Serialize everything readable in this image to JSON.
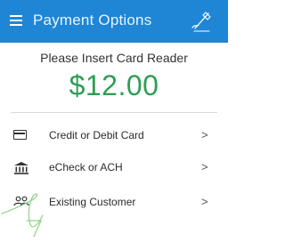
{
  "header": {
    "title": "Payment Options",
    "menu_icon": "hamburger-menu-icon",
    "signature_icon": "signature-pen-icon",
    "background": "#1f86d6"
  },
  "main": {
    "prompt": "Please Insert Card Reader",
    "amount": "$12.00",
    "amount_color": "#2e9e55"
  },
  "options": [
    {
      "label": "Credit or Debit Card",
      "icon": "credit-card-icon",
      "chevron": ">"
    },
    {
      "label": "eCheck or ACH",
      "icon": "bank-icon",
      "chevron": ">"
    },
    {
      "label": "Existing Customer",
      "icon": "people-icon",
      "chevron": ">"
    }
  ],
  "colors": {
    "signature_hint": "#8fd18a"
  }
}
